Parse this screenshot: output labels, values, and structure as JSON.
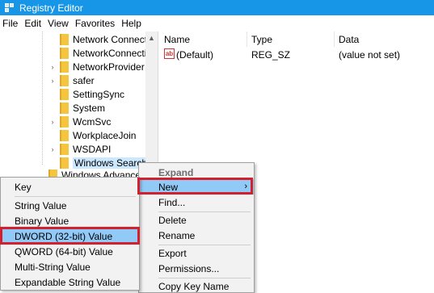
{
  "window": {
    "title": "Registry Editor",
    "icon": "registry-editor-icon"
  },
  "menubar": {
    "items": [
      "File",
      "Edit",
      "View",
      "Favorites",
      "Help"
    ]
  },
  "tree": {
    "items": [
      {
        "label": "Network Connecti",
        "expander": "",
        "selected": false
      },
      {
        "label": "NetworkConnectiv",
        "expander": "",
        "selected": false
      },
      {
        "label": "NetworkProvider",
        "expander": "›",
        "selected": false
      },
      {
        "label": "safer",
        "expander": "›",
        "selected": false
      },
      {
        "label": "SettingSync",
        "expander": "",
        "selected": false
      },
      {
        "label": "System",
        "expander": "",
        "selected": false
      },
      {
        "label": "WcmSvc",
        "expander": "›",
        "selected": false
      },
      {
        "label": "WorkplaceJoin",
        "expander": "",
        "selected": false
      },
      {
        "label": "WSDAPI",
        "expander": "›",
        "selected": false
      },
      {
        "label": "Windows Search",
        "expander": "",
        "selected": true
      },
      {
        "label": "Windows Advanced",
        "expander": "",
        "selected": false
      }
    ]
  },
  "list": {
    "columns": {
      "name": "Name",
      "type": "Type",
      "data": "Data"
    },
    "rows": [
      {
        "name": "(Default)",
        "type": "REG_SZ",
        "data": "(value not set)",
        "icon": "string-value-icon"
      }
    ]
  },
  "context_menu": {
    "header": "Expand",
    "items": [
      "New",
      "Find...",
      "Delete",
      "Rename",
      "Export",
      "Permissions...",
      "Copy Key Name"
    ],
    "highlighted": "New",
    "submenu_arrow": "›"
  },
  "new_submenu": {
    "items": [
      "Key",
      "String Value",
      "Binary Value",
      "DWORD (32-bit) Value",
      "QWORD (64-bit) Value",
      "Multi-String Value",
      "Expandable String Value"
    ],
    "highlighted": "DWORD (32-bit) Value"
  },
  "colors": {
    "titlebar": "#1795e6",
    "highlight": "#91c9f7",
    "annotation": "#d4202c",
    "selection": "#cce8ff"
  }
}
